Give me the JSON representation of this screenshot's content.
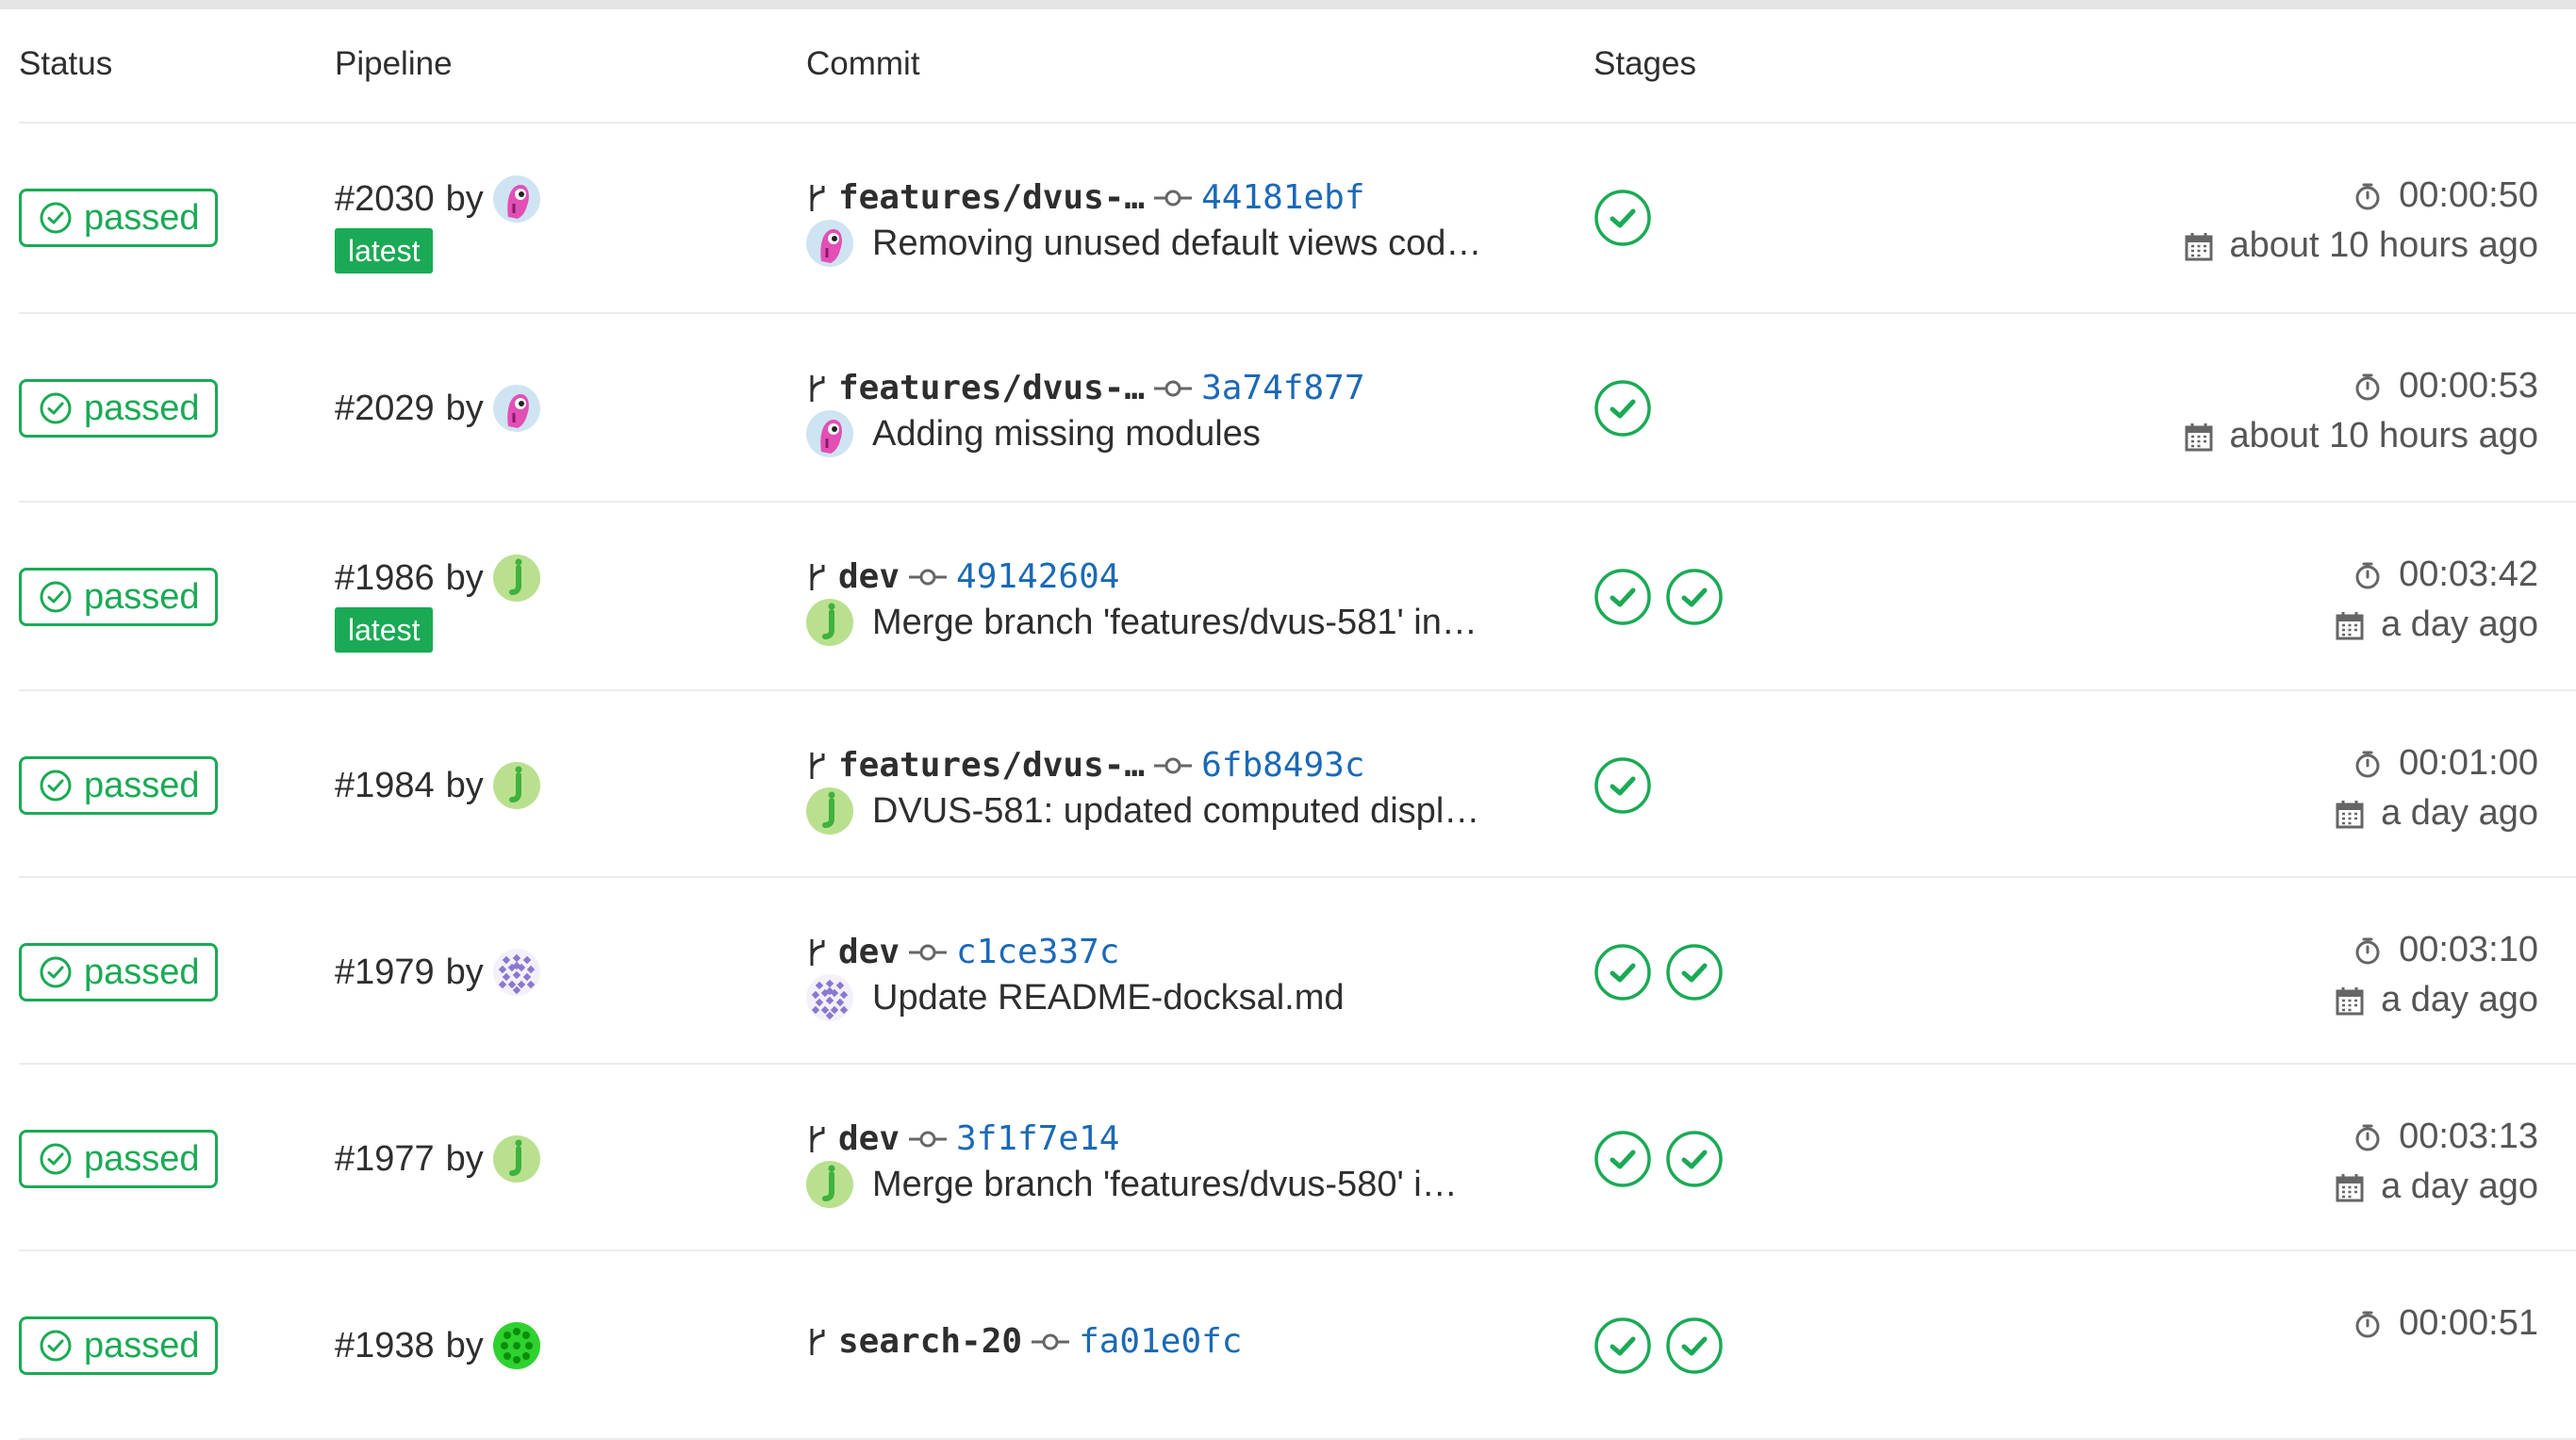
{
  "header": {
    "status": "Status",
    "pipeline": "Pipeline",
    "commit": "Commit",
    "stages": "Stages"
  },
  "pipelines": [
    {
      "status": "passed",
      "id": "#2030",
      "by": "by",
      "latest": "latest",
      "avatar": "pink",
      "branch": "features/dvus-…",
      "sha": "44181ebf",
      "commit_avatar": "pink",
      "message": "Removing unused default views cod…",
      "stages": 1,
      "duration": "00:00:50",
      "finished": "about 10 hours ago"
    },
    {
      "status": "passed",
      "id": "#2029",
      "by": "by",
      "latest": "",
      "avatar": "pink",
      "branch": "features/dvus-…",
      "sha": "3a74f877",
      "commit_avatar": "pink",
      "message": "Adding missing modules",
      "stages": 1,
      "duration": "00:00:53",
      "finished": "about 10 hours ago"
    },
    {
      "status": "passed",
      "id": "#1986",
      "by": "by",
      "latest": "latest",
      "avatar": "j",
      "branch": "dev",
      "sha": "49142604",
      "commit_avatar": "j",
      "message": "Merge branch 'features/dvus-581' in…",
      "stages": 2,
      "duration": "00:03:42",
      "finished": "a day ago"
    },
    {
      "status": "passed",
      "id": "#1984",
      "by": "by",
      "latest": "",
      "avatar": "j",
      "branch": "features/dvus-…",
      "sha": "6fb8493c",
      "commit_avatar": "j",
      "message": "DVUS-581: updated computed displ…",
      "stages": 1,
      "duration": "00:01:00",
      "finished": "a day ago"
    },
    {
      "status": "passed",
      "id": "#1979",
      "by": "by",
      "latest": "",
      "avatar": "purple",
      "branch": "dev",
      "sha": "c1ce337c",
      "commit_avatar": "purple",
      "message": "Update README-docksal.md",
      "stages": 2,
      "duration": "00:03:10",
      "finished": "a day ago"
    },
    {
      "status": "passed",
      "id": "#1977",
      "by": "by",
      "latest": "",
      "avatar": "j",
      "branch": "dev",
      "sha": "3f1f7e14",
      "commit_avatar": "j",
      "message": "Merge branch 'features/dvus-580' i…",
      "stages": 2,
      "duration": "00:03:13",
      "finished": "a day ago"
    },
    {
      "status": "passed",
      "id": "#1938",
      "by": "by",
      "latest": "",
      "avatar": "green",
      "branch": "search-20",
      "sha": "fa01e0fc",
      "commit_avatar": "green",
      "message": "",
      "stages": 2,
      "duration": "00:00:51",
      "finished": ""
    }
  ],
  "colors": {
    "success": "#1aaa55",
    "link": "#1b69b6"
  }
}
